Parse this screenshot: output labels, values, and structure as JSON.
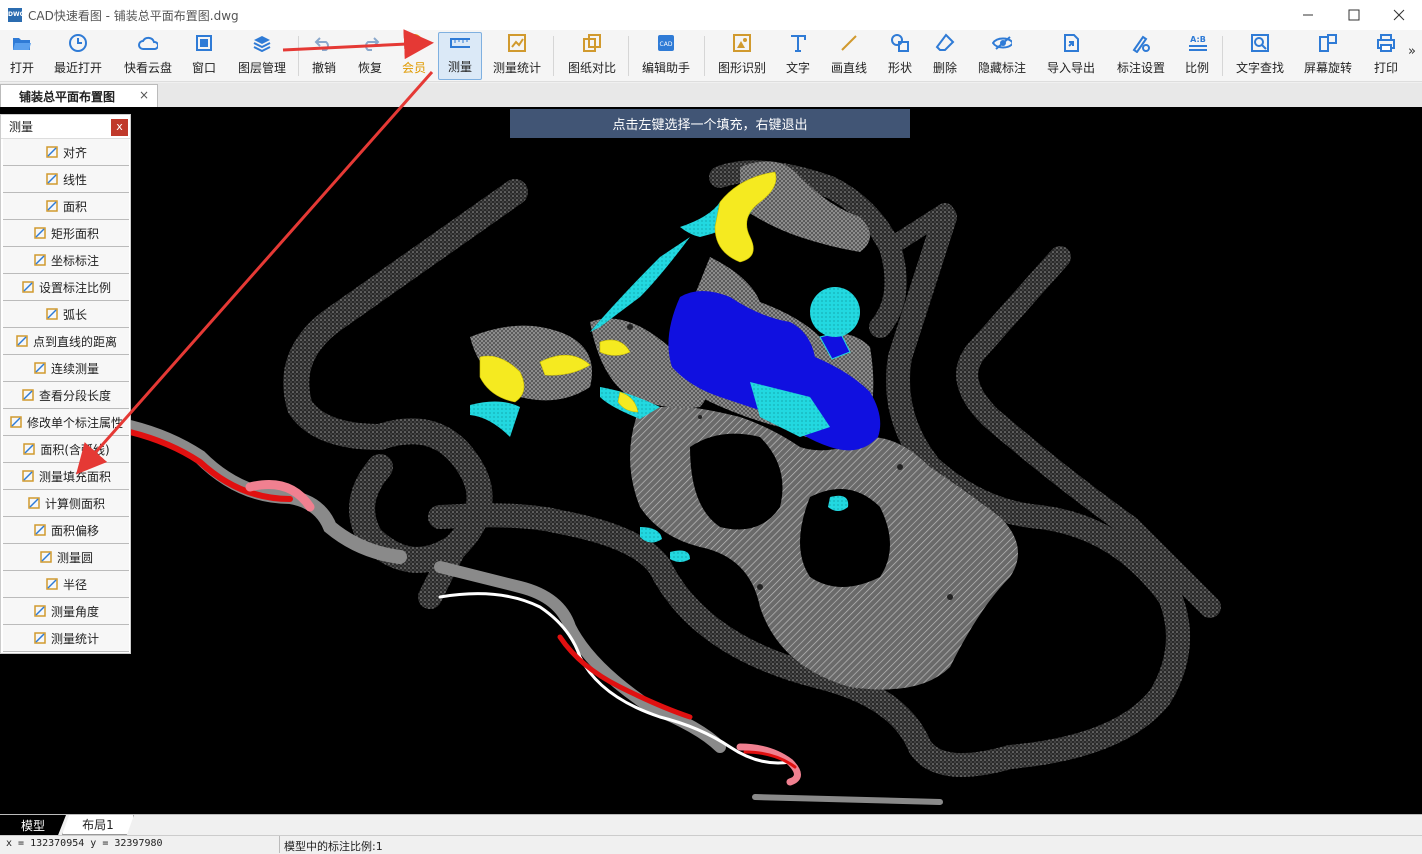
{
  "window": {
    "title": "CAD快速看图 - 铺装总平面布置图.dwg",
    "app_icon_text": "DWG"
  },
  "toolbar": {
    "items": [
      {
        "label": "打开",
        "icon": "folder-open-icon"
      },
      {
        "label": "最近打开",
        "icon": "clock-icon"
      },
      {
        "label": "快看云盘",
        "icon": "cloud-icon"
      },
      {
        "label": "窗口",
        "icon": "window-icon"
      },
      {
        "label": "图层管理",
        "icon": "layers-icon"
      },
      {
        "label": "撤销",
        "icon": "undo-icon"
      },
      {
        "label": "恢复",
        "icon": "redo-icon"
      },
      {
        "label": "会员",
        "icon": "vip-icon"
      },
      {
        "label": "测量",
        "icon": "ruler-icon"
      },
      {
        "label": "测量统计",
        "icon": "measure-stats-icon"
      },
      {
        "label": "图纸对比",
        "icon": "compare-icon"
      },
      {
        "label": "编辑助手",
        "icon": "cad-edit-icon"
      },
      {
        "label": "图形识别",
        "icon": "shape-recognize-icon"
      },
      {
        "label": "文字",
        "icon": "text-icon"
      },
      {
        "label": "画直线",
        "icon": "line-icon"
      },
      {
        "label": "形状",
        "icon": "shapes-icon"
      },
      {
        "label": "删除",
        "icon": "eraser-icon"
      },
      {
        "label": "隐藏标注",
        "icon": "eye-hide-icon"
      },
      {
        "label": "导入导出",
        "icon": "import-export-icon"
      },
      {
        "label": "标注设置",
        "icon": "annotation-settings-icon"
      },
      {
        "label": "比例",
        "icon": "scale-icon"
      },
      {
        "label": "文字查找",
        "icon": "text-search-icon"
      },
      {
        "label": "屏幕旋转",
        "icon": "rotate-screen-icon"
      },
      {
        "label": "打印",
        "icon": "printer-icon"
      }
    ],
    "overflow": "»"
  },
  "document_tab": {
    "label": "铺装总平面布置图",
    "close": "×"
  },
  "prompt": "点击左键选择一个填充，右键退出",
  "measure_panel": {
    "title": "测量",
    "close": "x",
    "items": [
      {
        "label": "对齐",
        "icon": "align-measure-icon"
      },
      {
        "label": "线性",
        "icon": "linear-measure-icon"
      },
      {
        "label": "面积",
        "icon": "area-icon"
      },
      {
        "label": "矩形面积",
        "icon": "rect-area-icon"
      },
      {
        "label": "坐标标注",
        "icon": "coordinate-icon"
      },
      {
        "label": "设置标注比例",
        "icon": "scale-icon"
      },
      {
        "label": "弧长",
        "icon": "arc-length-icon"
      },
      {
        "label": "点到直线的距离",
        "icon": "point-line-distance-icon"
      },
      {
        "label": "连续测量",
        "icon": "continuous-measure-icon"
      },
      {
        "label": "查看分段长度",
        "icon": "segment-length-icon"
      },
      {
        "label": "修改单个标注属性",
        "icon": "edit-annotation-icon"
      },
      {
        "label": "面积(含弧线)",
        "icon": "arc-area-icon"
      },
      {
        "label": "测量填充面积",
        "icon": "fill-area-icon"
      },
      {
        "label": "计算侧面积",
        "icon": "side-area-icon"
      },
      {
        "label": "面积偏移",
        "icon": "area-offset-icon"
      },
      {
        "label": "测量圆",
        "icon": "circle-measure-icon"
      },
      {
        "label": "半径",
        "icon": "radius-icon"
      },
      {
        "label": "测量角度",
        "icon": "angle-icon"
      },
      {
        "label": "测量统计",
        "icon": "measure-stats-icon"
      }
    ]
  },
  "layout_tabs": {
    "model": "模型",
    "layout1": "布局1"
  },
  "status": {
    "coords": "x = 132370954  y = 32397980",
    "scale": "模型中的标注比例:1"
  },
  "colors": {
    "canvas_bg": "#000000",
    "paving_gray": "#8a8a8a",
    "fill_blue": "#1010e0",
    "fill_cyan": "#22d8e0",
    "fill_yellow": "#f5ea20",
    "fill_red": "#e01010",
    "fill_pink": "#f08090",
    "arrow_red": "#e53935",
    "prompt_bg": "#415575"
  }
}
